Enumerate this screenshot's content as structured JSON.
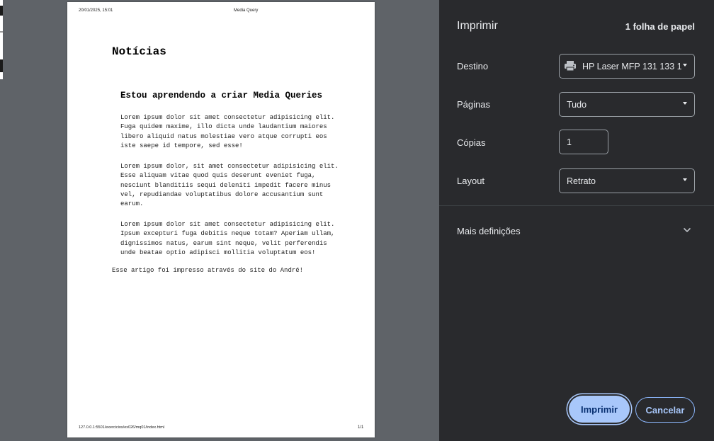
{
  "preview": {
    "header_date": "20/01/2025, 15:01",
    "header_title": "Media Query",
    "footer_url": "127.0.0.1:5501/exercicios/ex026/mq01/index.html",
    "footer_page": "1/1",
    "doc": {
      "h1": "Notícias",
      "h2": "Estou aprendendo a criar Media Queries",
      "paragraphs": [
        "Lorem ipsum dolor sit amet consectetur adipisicing elit. Fuga quidem maxime, illo dicta unde laudantium maiores libero aliquid natus molestiae vero atque corrupti eos iste saepe id tempore, sed esse!",
        "Lorem ipsum dolor, sit amet consectetur adipisicing elit. Esse aliquam vitae quod quis deserunt eveniet fuga, nesciunt blanditiis sequi deleniti impedit facere minus vel, repudiandae voluptatibus dolore accusantium sunt earum.",
        "Lorem ipsum dolor sit amet consectetur adipisicing elit. Ipsum excepturi fuga debitis neque totam? Aperiam ullam, dignissimos natus, earum sint neque, velit perferendis unde beatae optio adipisci mollitia voluptatum eos!"
      ],
      "footer": "Esse artigo foi impresso através do site do André!"
    }
  },
  "panel": {
    "title": "Imprimir",
    "sheet_count": "1 folha de papel",
    "destination": {
      "label": "Destino",
      "value": "HP Laser MFP 131 133 1",
      "icon": "printer-icon"
    },
    "pages": {
      "label": "Páginas",
      "value": "Tudo"
    },
    "copies": {
      "label": "Cópias",
      "value": "1"
    },
    "layout": {
      "label": "Layout",
      "value": "Retrato"
    },
    "more_settings": {
      "label": "Mais definições",
      "icon": "chevron-down-icon"
    },
    "print_button": "Imprimir",
    "cancel_button": "Cancelar",
    "colors": {
      "panel_bg": "#292a2d",
      "primary": "#a8c7fa",
      "preview_bg": "#5f6368"
    }
  }
}
